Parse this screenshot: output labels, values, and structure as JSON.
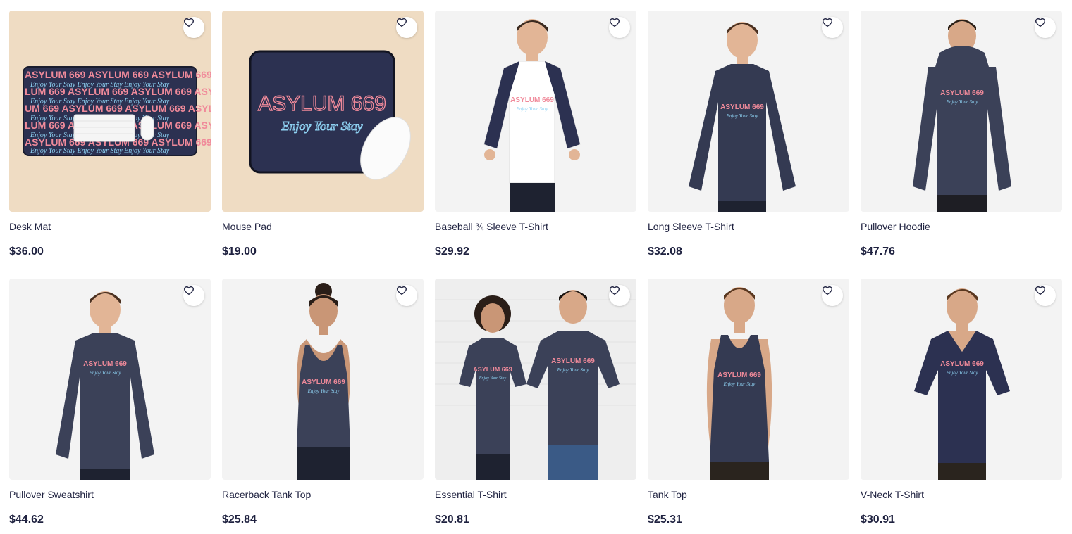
{
  "products": [
    {
      "name": "Desk Mat",
      "price": "$36.00",
      "image": "desk-mat",
      "bg": "#efdcc3"
    },
    {
      "name": "Mouse Pad",
      "price": "$19.00",
      "image": "mouse-pad",
      "bg": "#efdcc3"
    },
    {
      "name": "Baseball ¾ Sleeve T-Shirt",
      "price": "$29.92",
      "image": "baseball-shirt",
      "bg": "#f3f3f3"
    },
    {
      "name": "Long Sleeve T-Shirt",
      "price": "$32.08",
      "image": "long-sleeve",
      "bg": "#f3f3f3"
    },
    {
      "name": "Pullover Hoodie",
      "price": "$47.76",
      "image": "hoodie",
      "bg": "#f3f3f3"
    },
    {
      "name": "Pullover Sweatshirt",
      "price": "$44.62",
      "image": "sweatshirt",
      "bg": "#f3f3f3"
    },
    {
      "name": "Racerback Tank Top",
      "price": "$25.84",
      "image": "racerback",
      "bg": "#f3f3f3"
    },
    {
      "name": "Essential T-Shirt",
      "price": "$20.81",
      "image": "essential-tee",
      "bg": "#eeeeee"
    },
    {
      "name": "Tank Top",
      "price": "$25.31",
      "image": "tank-top",
      "bg": "#f3f3f3"
    },
    {
      "name": "V-Neck T-Shirt",
      "price": "$30.91",
      "image": "vneck",
      "bg": "#f3f3f3"
    }
  ],
  "design_text": {
    "line1": "ASYLUM 669",
    "line2": "Enjoy Your Stay"
  },
  "colors": {
    "navy": "#343a52",
    "neon_pink": "#f08a9a",
    "neon_blue": "#8fd3f4",
    "text": "#1f2240"
  }
}
